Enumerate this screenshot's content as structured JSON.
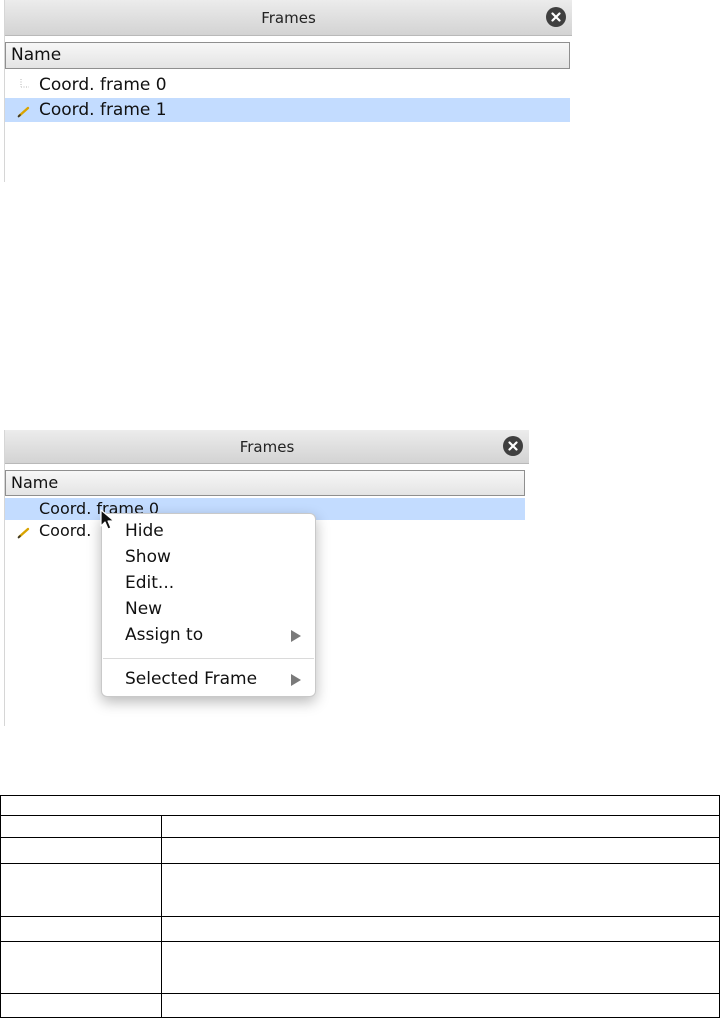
{
  "panels": [
    {
      "title": "Frames",
      "column_header": "Name",
      "rows": [
        {
          "label": "Coord. frame 0",
          "selected": false,
          "icon": "tree-line-icon"
        },
        {
          "label": "Coord. frame 1",
          "selected": true,
          "icon": "pencil-icon"
        }
      ]
    },
    {
      "title": "Frames",
      "column_header": "Name",
      "rows": [
        {
          "label": "Coord. frame 0",
          "selected": true,
          "icon": "none"
        },
        {
          "label": "Coord. ",
          "selected": false,
          "icon": "pencil-icon"
        }
      ]
    }
  ],
  "context_menu": {
    "items": [
      {
        "label": "Hide",
        "submenu": false
      },
      {
        "label": "Show",
        "submenu": false
      },
      {
        "label": "Edit...",
        "submenu": false
      },
      {
        "label": "New",
        "submenu": false
      },
      {
        "label": "Assign to",
        "submenu": true
      },
      {
        "label": "Selected Frame",
        "submenu": true
      }
    ]
  },
  "colors": {
    "selection": "#c3dcff",
    "titlebar": "#dcdcdc",
    "close_button": "#3f3f3f",
    "pencil": "#d9a400"
  }
}
